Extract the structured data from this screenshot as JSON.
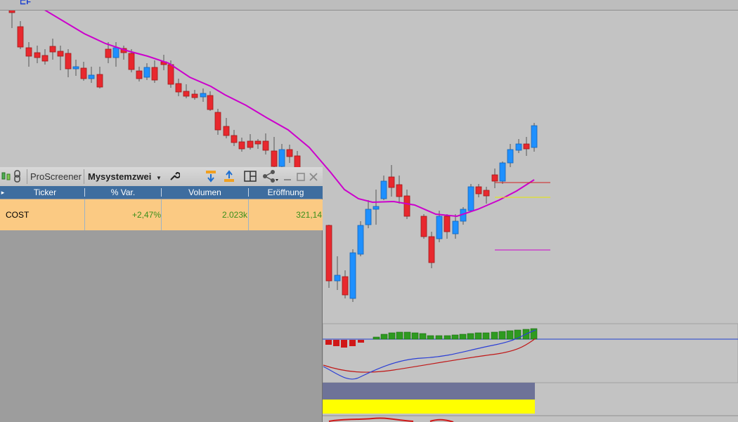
{
  "screener": {
    "title": "ProScreener",
    "system_name": "Mysystemzwei",
    "columns": [
      "Ticker",
      "% Var.",
      "Volumen",
      "Eröffnung"
    ],
    "rows": [
      {
        "ticker": "COST",
        "var": "+2,47%",
        "volume": "2.023k",
        "open": "321,14"
      }
    ]
  },
  "colors": {
    "bull": "#1e90ff",
    "bear": "#e8282e",
    "ma": "#cc00cc",
    "row_highlight": "#fbca83",
    "header": "#3e6d9f",
    "hist_positive": "#2e9a20",
    "hist_negative": "#d01818"
  },
  "icons": [
    "candlestick-icon",
    "link-icon",
    "wrench-icon",
    "sort-descending-icon",
    "sort-ascending-icon",
    "layout-icon",
    "share-icon",
    "minimize-icon",
    "maximize-icon",
    "close-icon",
    "chevron-down-icon"
  ]
}
